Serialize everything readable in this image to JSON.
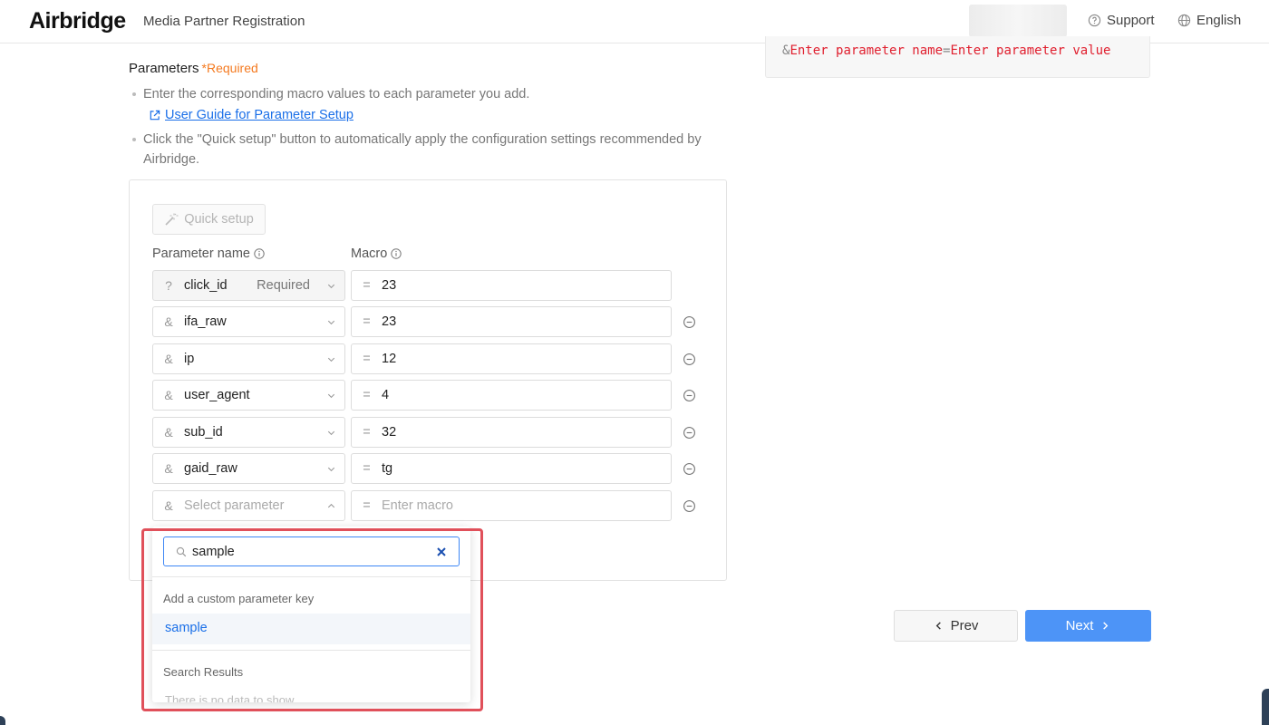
{
  "header": {
    "logo": "Airbridge",
    "title": "Media Partner Registration",
    "support_label": "Support",
    "language_label": "English"
  },
  "url_preview": {
    "amp": "&",
    "name_placeholder": "Enter parameter name",
    "equals": "=",
    "value_placeholder": "Enter parameter value"
  },
  "parameters": {
    "title": "Parameters",
    "required_label": "*Required",
    "bullet_1": "Enter the corresponding macro values to each parameter you add.",
    "guide_link": "User Guide for Parameter Setup",
    "bullet_2": "Click the \"Quick setup\" button to automatically apply the configuration settings recommended by Airbridge.",
    "quick_setup_label": "Quick setup",
    "col_param": "Parameter name",
    "col_macro": "Macro",
    "rows": [
      {
        "symbol": "?",
        "name": "click_id",
        "badge": "Required",
        "macro": "23"
      },
      {
        "symbol": "&",
        "name": "ifa_raw",
        "macro": "23"
      },
      {
        "symbol": "&",
        "name": "ip",
        "macro": "12"
      },
      {
        "symbol": "&",
        "name": "user_agent",
        "macro": "4"
      },
      {
        "symbol": "&",
        "name": "sub_id",
        "macro": "32"
      },
      {
        "symbol": "&",
        "name": "gaid_raw",
        "macro": "tg"
      },
      {
        "symbol": "&",
        "name_placeholder": "Select parameter",
        "macro_placeholder": "Enter macro"
      }
    ],
    "macro_eq": "="
  },
  "dropdown": {
    "search_value": "sample",
    "custom_group": "Add a custom parameter key",
    "custom_option": "sample",
    "results_group": "Search Results",
    "empty_text": "There is no data to show"
  },
  "footer": {
    "prev_label": "Prev",
    "next_label": "Next"
  },
  "colors": {
    "accent": "#4d94f7",
    "link": "#1a6fe8",
    "required": "#f47a20",
    "highlight": "#e0505a"
  }
}
